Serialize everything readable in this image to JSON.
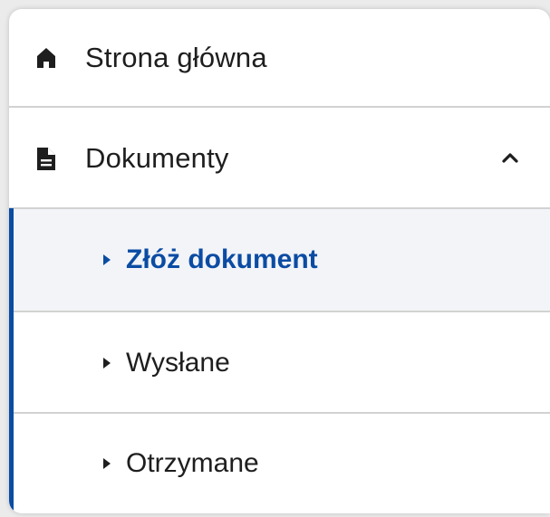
{
  "menu": {
    "home": {
      "label": "Strona główna",
      "icon": "home-icon"
    },
    "documents": {
      "label": "Dokumenty",
      "icon": "document-icon",
      "expanded": true
    },
    "sub_items": [
      {
        "label": "Złóż dokument",
        "active": true
      },
      {
        "label": "Wysłane",
        "active": false
      },
      {
        "label": "Otrzymane",
        "active": false
      }
    ]
  },
  "colors": {
    "accent": "#0b4ca3",
    "active_bg": "#f2f4f8",
    "text": "#1e1e1e",
    "divider": "#d2d2d2"
  }
}
